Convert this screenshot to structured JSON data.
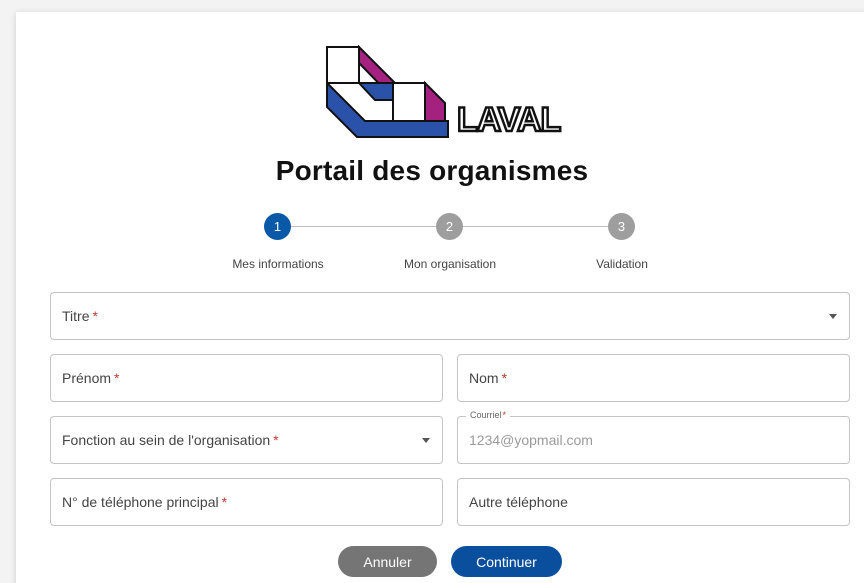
{
  "header": {
    "logo_text": "LAVAL",
    "title": "Portail des organismes"
  },
  "stepper": {
    "steps": [
      {
        "number": "1",
        "label": "Mes informations",
        "state": "active"
      },
      {
        "number": "2",
        "label": "Mon organisation",
        "state": "inactive"
      },
      {
        "number": "3",
        "label": "Validation",
        "state": "inactive"
      }
    ]
  },
  "form": {
    "titre": {
      "label": "Titre",
      "required": "*"
    },
    "prenom": {
      "label": "Prénom",
      "required": "*"
    },
    "nom": {
      "label": "Nom",
      "required": "*"
    },
    "fonction": {
      "label": "Fonction au sein de l'organisation",
      "required": "*"
    },
    "courriel": {
      "label": "Courriel",
      "required": "*",
      "value": "1234@yopmail.com"
    },
    "telephone": {
      "label": "N° de téléphone principal",
      "required": "*"
    },
    "autre_telephone": {
      "label": "Autre téléphone"
    }
  },
  "actions": {
    "cancel_label": "Annuler",
    "continue_label": "Continuer"
  },
  "colors": {
    "primary": "#0a58a8",
    "step_inactive": "#9e9e9e",
    "cancel": "#757575",
    "logo_magenta": "#a4217f",
    "logo_blue": "#2a52a8"
  }
}
